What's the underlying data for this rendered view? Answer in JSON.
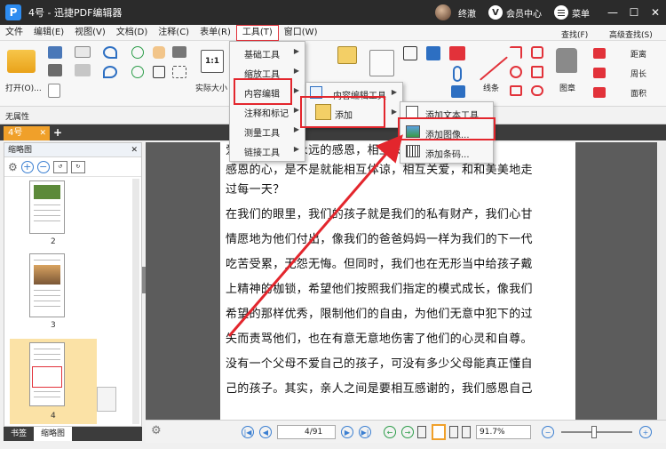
{
  "window": {
    "title": "4号 - 迅捷PDF编辑器",
    "logo_glyph": "P",
    "username": "终澈",
    "vip_label": "会员中心",
    "vip_glyph": "V",
    "menu_label": "菜单",
    "minimize": "—",
    "maximize": "☐",
    "close": "✕"
  },
  "menubar": {
    "items": [
      "文件",
      "编辑(E)",
      "视图(V)",
      "文档(D)",
      "注释(C)",
      "表单(R)",
      "工具(T)",
      "窗口(W)"
    ],
    "active_index": 6
  },
  "ribbon": {
    "open_label": "打开(O)...",
    "actual_size_label": "实际大小",
    "actual_size_glyph": "1:1",
    "line_label": "线条",
    "stamp_label": "图章",
    "find_label": "查找(F)",
    "advanced_find_label": "高级查找(S)",
    "distance_label": "距离",
    "perimeter_label": "周长",
    "area_label": "面积"
  },
  "properties": {
    "label": "无属性"
  },
  "doc_tabs": {
    "active_tab": "4号",
    "close_glyph": "✕",
    "add_glyph": "+"
  },
  "side_panel": {
    "title": "缩略图",
    "close_glyph": "✕",
    "thumbnails": [
      "2",
      "3",
      "4"
    ],
    "bottom_tabs": [
      "书签",
      "缩略图"
    ],
    "active_bottom_tab": 1
  },
  "document": {
    "lines": [
      "爱便能够变是永远的感恩，相互关爱中够",
      "感恩的心，是不是就能相互体谅，相互关爱，和和美美地走",
      "过每一天？",
      "在我们的眼里，我们的孩子就是我们的私有财产，我们心甘",
      "情愿地为他们付出，像我们的爸爸妈妈一样为我们的下一代",
      "吃苦受累，无怨无悔。但同时，我们也在无形当中给孩子戴",
      "上精神的枷锁，希望他们按照我们指定的模式成长，像我们",
      "希望的那样优秀，限制他们的自由，为他们无意中犯下的过",
      "失而责骂他们，也在有意无意地伤害了他们的心灵和自尊。",
      "没有一个父母不爱自己的孩子，可没有多少父母能真正懂自",
      "己的孩子。其实，亲人之间是要相互感谢的，我们感恩自己"
    ]
  },
  "status_bar": {
    "current_page": "4",
    "total_pages": "/91",
    "zoom": "91.7%",
    "first_page_glyph": "|◀",
    "prev_page_glyph": "◀",
    "next_page_glyph": "▶",
    "last_page_glyph": "▶|"
  },
  "tools_menu": {
    "items": [
      "基础工具",
      "缩放工具",
      "内容编辑",
      "注释和标记",
      "测量工具",
      "链接工具"
    ],
    "highlighted_index": 2
  },
  "content_edit_submenu": {
    "items": [
      "内容编辑工具",
      "添加"
    ],
    "highlighted_index": 1
  },
  "add_submenu": {
    "items": [
      "添加文本工具",
      "添加图像...",
      "添加条码..."
    ],
    "highlighted_index": 1
  },
  "colors": {
    "highlight_red": "#e3262d",
    "accent_orange": "#f0a02a",
    "title_bg": "#2b2b2b",
    "accent_blue": "#3b7fd1"
  }
}
